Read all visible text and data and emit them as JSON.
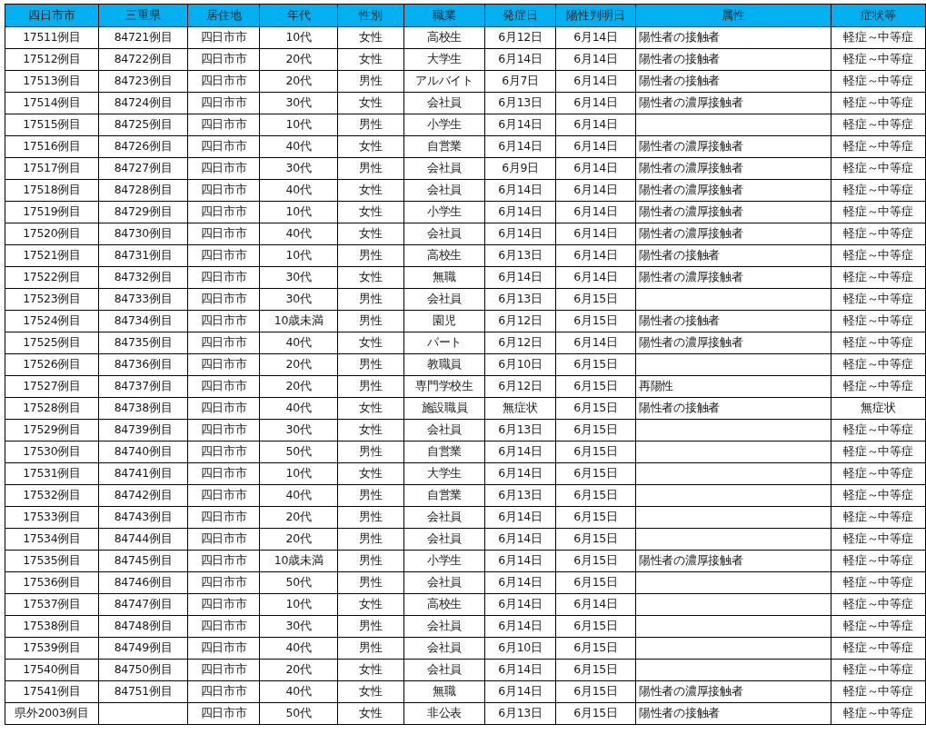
{
  "table": {
    "columns": [
      "四日市市",
      "三重県",
      "居住地",
      "年代",
      "性別",
      "職業",
      "発症日",
      "陽性判明日",
      "属性",
      "症状等"
    ],
    "rows": [
      [
        "17511例目",
        "84721例目",
        "四日市市",
        "10代",
        "女性",
        "高校生",
        "6月12日",
        "6月14日",
        "陽性者の接触者",
        "軽症～中等症"
      ],
      [
        "17512例目",
        "84722例目",
        "四日市市",
        "20代",
        "女性",
        "大学生",
        "6月14日",
        "6月14日",
        "陽性者の接触者",
        "軽症～中等症"
      ],
      [
        "17513例目",
        "84723例目",
        "四日市市",
        "20代",
        "男性",
        "アルバイト",
        "6月7日",
        "6月14日",
        "陽性者の接触者",
        "軽症～中等症"
      ],
      [
        "17514例目",
        "84724例目",
        "四日市市",
        "30代",
        "女性",
        "会社員",
        "6月13日",
        "6月14日",
        "陽性者の濃厚接触者",
        "軽症～中等症"
      ],
      [
        "17515例目",
        "84725例目",
        "四日市市",
        "10代",
        "男性",
        "小学生",
        "6月14日",
        "6月14日",
        null,
        "軽症～中等症"
      ],
      [
        "17516例目",
        "84726例目",
        "四日市市",
        "40代",
        "女性",
        "自営業",
        "6月14日",
        "6月14日",
        "陽性者の濃厚接触者",
        "軽症～中等症"
      ],
      [
        "17517例目",
        "84727例目",
        "四日市市",
        "30代",
        "男性",
        "会社員",
        "6月9日",
        "6月14日",
        "陽性者の濃厚接触者",
        "軽症～中等症"
      ],
      [
        "17518例目",
        "84728例目",
        "四日市市",
        "40代",
        "女性",
        "会社員",
        "6月14日",
        "6月14日",
        "陽性者の濃厚接触者",
        "軽症～中等症"
      ],
      [
        "17519例目",
        "84729例目",
        "四日市市",
        "10代",
        "女性",
        "小学生",
        "6月14日",
        "6月14日",
        "陽性者の濃厚接触者",
        "軽症～中等症"
      ],
      [
        "17520例目",
        "84730例目",
        "四日市市",
        "40代",
        "女性",
        "会社員",
        "6月14日",
        "6月14日",
        "陽性者の濃厚接触者",
        "軽症～中等症"
      ],
      [
        "17521例目",
        "84731例目",
        "四日市市",
        "10代",
        "男性",
        "高校生",
        "6月13日",
        "6月14日",
        "陽性者の接触者",
        "軽症～中等症"
      ],
      [
        "17522例目",
        "84732例目",
        "四日市市",
        "30代",
        "女性",
        "無職",
        "6月14日",
        "6月14日",
        "陽性者の濃厚接触者",
        "軽症～中等症"
      ],
      [
        "17523例目",
        "84733例目",
        "四日市市",
        "30代",
        "男性",
        "会社員",
        "6月13日",
        "6月15日",
        null,
        "軽症～中等症"
      ],
      [
        "17524例目",
        "84734例目",
        "四日市市",
        "10歳未満",
        "男性",
        "園児",
        "6月12日",
        "6月15日",
        "陽性者の接触者",
        "軽症～中等症"
      ],
      [
        "17525例目",
        "84735例目",
        "四日市市",
        "40代",
        "女性",
        "パート",
        "6月12日",
        "6月14日",
        "陽性者の濃厚接触者",
        "軽症～中等症"
      ],
      [
        "17526例目",
        "84736例目",
        "四日市市",
        "20代",
        "男性",
        "教職員",
        "6月10日",
        "6月15日",
        null,
        "軽症～中等症"
      ],
      [
        "17527例目",
        "84737例目",
        "四日市市",
        "20代",
        "男性",
        "専門学校生",
        "6月12日",
        "6月15日",
        "再陽性",
        "軽症～中等症"
      ],
      [
        "17528例目",
        "84738例目",
        "四日市市",
        "40代",
        "女性",
        "施設職員",
        "無症状",
        "6月15日",
        "陽性者の接触者",
        "無症状"
      ],
      [
        "17529例目",
        "84739例目",
        "四日市市",
        "30代",
        "女性",
        "会社員",
        "6月13日",
        "6月15日",
        null,
        "軽症～中等症"
      ],
      [
        "17530例目",
        "84740例目",
        "四日市市",
        "50代",
        "男性",
        "自営業",
        "6月14日",
        "6月15日",
        null,
        "軽症～中等症"
      ],
      [
        "17531例目",
        "84741例目",
        "四日市市",
        "10代",
        "女性",
        "大学生",
        "6月14日",
        "6月15日",
        null,
        "軽症～中等症"
      ],
      [
        "17532例目",
        "84742例目",
        "四日市市",
        "40代",
        "男性",
        "自営業",
        "6月13日",
        "6月15日",
        null,
        "軽症～中等症"
      ],
      [
        "17533例目",
        "84743例目",
        "四日市市",
        "20代",
        "男性",
        "会社員",
        "6月14日",
        "6月15日",
        null,
        "軽症～中等症"
      ],
      [
        "17534例目",
        "84744例目",
        "四日市市",
        "20代",
        "男性",
        "会社員",
        "6月14日",
        "6月15日",
        null,
        "軽症～中等症"
      ],
      [
        "17535例目",
        "84745例目",
        "四日市市",
        "10歳未満",
        "男性",
        "小学生",
        "6月14日",
        "6月15日",
        "陽性者の濃厚接触者",
        "軽症～中等症"
      ],
      [
        "17536例目",
        "84746例目",
        "四日市市",
        "50代",
        "男性",
        "会社員",
        "6月14日",
        "6月15日",
        null,
        "軽症～中等症"
      ],
      [
        "17537例目",
        "84747例目",
        "四日市市",
        "10代",
        "女性",
        "高校生",
        "6月14日",
        "6月14日",
        null,
        "軽症～中等症"
      ],
      [
        "17538例目",
        "84748例目",
        "四日市市",
        "30代",
        "男性",
        "会社員",
        "6月14日",
        "6月15日",
        null,
        "軽症～中等症"
      ],
      [
        "17539例目",
        "84749例目",
        "四日市市",
        "40代",
        "男性",
        "会社員",
        "6月10日",
        "6月15日",
        null,
        "軽症～中等症"
      ],
      [
        "17540例目",
        "84750例目",
        "四日市市",
        "20代",
        "女性",
        "会社員",
        "6月14日",
        "6月15日",
        null,
        "軽症～中等症"
      ],
      [
        "17541例目",
        "84751例目",
        "四日市市",
        "40代",
        "女性",
        "無職",
        "6月14日",
        "6月15日",
        "陽性者の濃厚接触者",
        "軽症～中等症"
      ],
      [
        "県外2003例目",
        null,
        "四日市市",
        "50代",
        "女性",
        "非公表",
        "6月13日",
        "6月15日",
        "陽性者の接触者",
        "軽症～中等症"
      ]
    ]
  }
}
